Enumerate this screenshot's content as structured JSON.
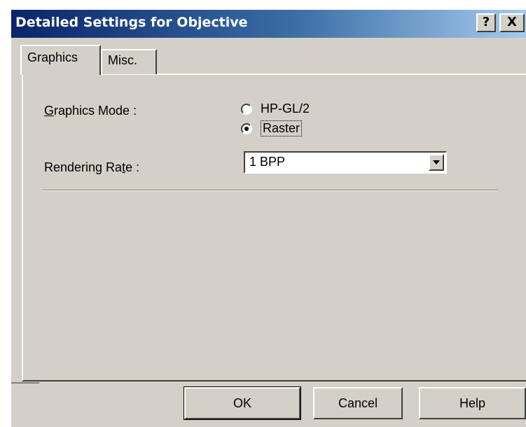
{
  "window": {
    "title": "Detailed Settings for Objective",
    "help_label": "?",
    "close_label": "X"
  },
  "tabs": [
    {
      "label": "Graphics",
      "active": true
    },
    {
      "label": "Misc.",
      "active": false
    }
  ],
  "graphics_mode": {
    "label_prefix": "G",
    "label_rest": "raphics Mode :",
    "options": [
      {
        "label": "HP-GL/2",
        "selected": false
      },
      {
        "label": "Raster",
        "selected": true
      }
    ]
  },
  "rendering_rate": {
    "label_pre": "Rendering Ra",
    "label_underline": "t",
    "label_post": "e :",
    "value": "1 BPP"
  },
  "buttons": {
    "ok": "OK",
    "cancel": "Cancel",
    "help": "Help"
  },
  "colors": {
    "titlebar_start": "#0a246a",
    "titlebar_end": "#a6caf0",
    "face": "#d4d0c8"
  }
}
